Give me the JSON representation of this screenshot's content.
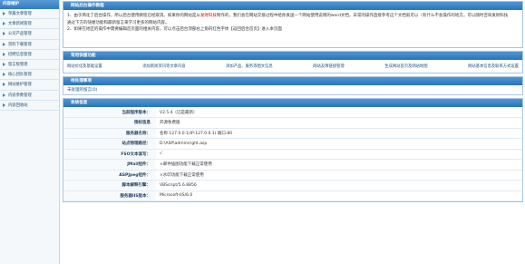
{
  "sidebar": {
    "title": "内容维护",
    "items": [
      {
        "label": "单篇文章管理"
      },
      {
        "label": "文章新闻管理"
      },
      {
        "label": "公司产品管理"
      },
      {
        "label": "资料下载管理"
      },
      {
        "label": "招聘信息管理"
      },
      {
        "label": "留言板管理"
      },
      {
        "label": "核心团队管理"
      },
      {
        "label": "网站维护管理"
      },
      {
        "label": "内容参数管理"
      },
      {
        "label": "内容回收站"
      }
    ]
  },
  "tutorial": {
    "title": "网站后台操作教程",
    "line1_a": "1、由于简化了后台操作，所以后台使用教程已经取消。如果你的网站是从",
    "line1_red": "发财科技",
    "line1_b": "制作的，我们会在网站交接过程中给你发送一个网站使用说明的word文档，日常的操作直接参考这个文档就可以（有什么不会操作的地方，可以随时咨询发财科技",
    "line1_c": "通过下方的快捷功能和最新留言来学习更多的网站内容。",
    "line2": "2、如果在地区的操作中需要编辑首页面的相关内容，可以点击后台顶部右上角的红色字体【返回后台首页】进入本页面"
  },
  "quick": {
    "title": "常用快捷功能",
    "links": [
      {
        "label": "网站优化及基础设置"
      },
      {
        "label": "添加新闻资讯等文章内容"
      },
      {
        "label": "添加产品、服务等图文信息"
      },
      {
        "label": "网站友情链接管理"
      },
      {
        "label": "生成网站首页及网站地图"
      },
      {
        "label": "网站基本信息及联系方式设置"
      }
    ]
  },
  "messages": {
    "title": "待处理事项",
    "link": "未处理的留言(0)"
  },
  "sysinfo": {
    "title": "系统信息",
    "rows": [
      {
        "k": "当前程序版本：",
        "v": "V2.5.4（已是最新）",
        "red": false
      },
      {
        "k": "授权信息",
        "v": "开源免费版",
        "red": false
      },
      {
        "k": "服务器名称：",
        "v": "名称 127.0.0.1(IP:127.0.0.1) 端口:80",
        "red": false
      },
      {
        "k": "站点物理路径：",
        "v": "D:\\ASP\\admin\\right.asp",
        "red": false
      },
      {
        "k": "FSO文本读写：",
        "v": "√",
        "red": false
      },
      {
        "k": "JMail组件：",
        "v": "×邮件插图功能下载正常使用",
        "red": true
      },
      {
        "k": "ASPJpeg组件：",
        "v": "×水印功能下载正常使用",
        "red": true
      },
      {
        "k": "脚本解释引擎：",
        "v": "VBScript/5.6.8856",
        "red": false
      },
      {
        "k": "服务器IIS版本：",
        "v": "Microsoft-IIS/6.0",
        "red": false
      }
    ]
  },
  "colors": {
    "header_blue": "#2f7bc2",
    "link_blue": "#1f4f86",
    "alert_red": "#e0262a"
  }
}
